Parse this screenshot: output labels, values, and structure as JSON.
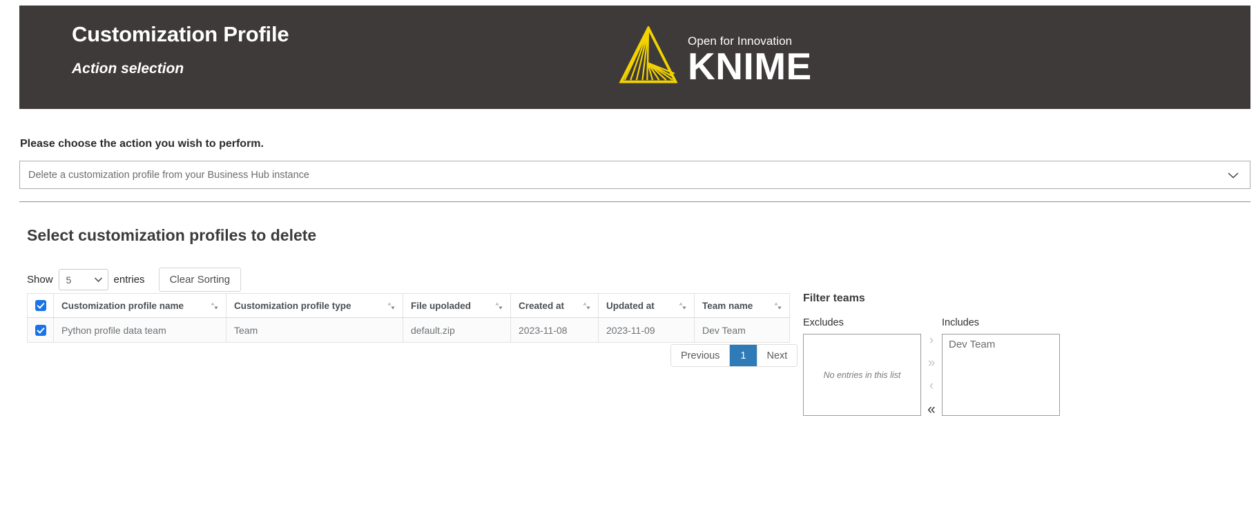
{
  "header": {
    "title": "Customization Profile",
    "subtitle": "Action selection",
    "background_color": "#3e3a39",
    "logo": {
      "mark_name": "knime-triangle-logo",
      "tagline": "Open for Innovation",
      "wordmark": "KNIME",
      "mark_color": "#f2d200"
    }
  },
  "action": {
    "label": "Please choose the action you wish to perform.",
    "selected_value": "Delete a customization profile from your Business Hub instance",
    "chevron_icon": "chevron-down-icon"
  },
  "table_section": {
    "heading": "Select customization profiles to delete",
    "controls": {
      "show_label": "Show",
      "entries_value": "5",
      "entries_label": "entries",
      "clear_sorting_label": "Clear Sorting"
    },
    "columns": [
      "Customization profile name",
      "Customization profile type",
      "File upoladed",
      "Created at",
      "Updated at",
      "Team name"
    ],
    "header_select_all_checked": true,
    "rows": [
      {
        "checked": true,
        "name": "Python profile data team",
        "type": "Team",
        "file": "default.zip",
        "created_at": "2023-11-08",
        "updated_at": "2023-11-09",
        "team": "Dev Team"
      }
    ],
    "pagination": {
      "previous_label": "Previous",
      "current_page": "1",
      "next_label": "Next",
      "active_color": "#2f7bb8"
    }
  },
  "filter_teams": {
    "title": "Filter teams",
    "excludes": {
      "label": "Excludes",
      "empty_text": "No entries in this list",
      "items": []
    },
    "includes": {
      "label": "Includes",
      "items": [
        "Dev Team"
      ]
    },
    "transfer_buttons": [
      {
        "name": "move-right-single",
        "glyph": "›",
        "enabled": false
      },
      {
        "name": "move-right-all",
        "glyph": "»",
        "enabled": false
      },
      {
        "name": "move-left-single",
        "glyph": "‹",
        "enabled": false
      },
      {
        "name": "move-left-all",
        "glyph": "«",
        "enabled": true
      }
    ]
  },
  "sort_icon_name": "sort-updown-icon"
}
